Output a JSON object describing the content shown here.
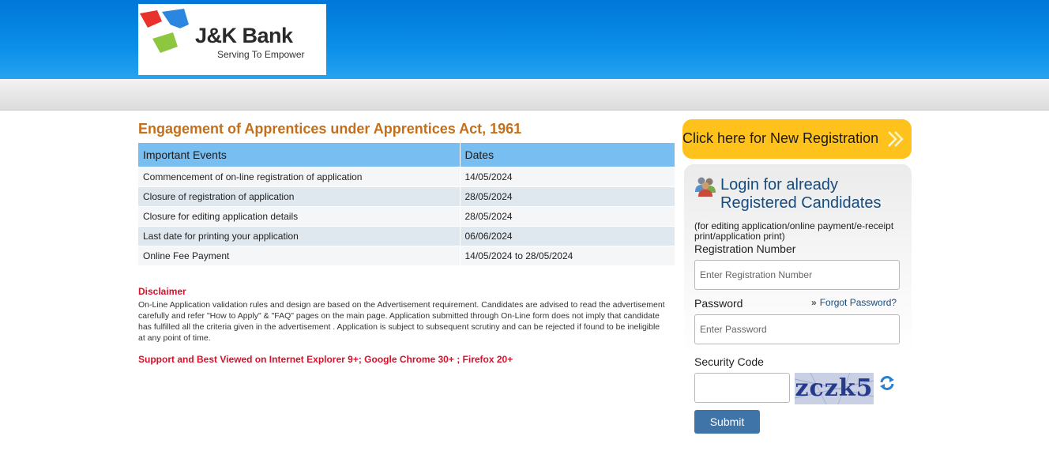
{
  "header": {
    "logo": {
      "name": "J&K Bank",
      "tagline": "Serving To Empower"
    }
  },
  "main": {
    "title": "Engagement of Apprentices under Apprentices Act, 1961",
    "table": {
      "headers": [
        "Important Events",
        "Dates"
      ],
      "rows": [
        {
          "event": "Commencement of on-line registration of application",
          "date": "14/05/2024"
        },
        {
          "event": "Closure of registration of application",
          "date": "28/05/2024"
        },
        {
          "event": "Closure for editing application details",
          "date": "28/05/2024"
        },
        {
          "event": "Last date for printing your application",
          "date": "06/06/2024"
        },
        {
          "event": "Online Fee Payment",
          "date": "14/05/2024 to 28/05/2024"
        }
      ]
    },
    "disclaimer": {
      "title": "Disclaimer",
      "text": "On-Line Application validation rules and design are based on the Advertisement requirement. Candidates are advised to read the advertisement carefully and refer \"How to Apply\" & \"FAQ\" pages on the main page. Application submitted through On-Line form does not imply that candidate has fulfilled all the criteria given in the advertisement . Application is subject to subsequent scrutiny and can be rejected if found to be ineligible at any point of time."
    },
    "support_note": "Support and Best Viewed on Internet Explorer 9+; Google Chrome 30+ ; Firefox 20+"
  },
  "sidebar": {
    "new_registration_label": "Click here for New Registration",
    "login": {
      "title": "Login for already Registered Candidates",
      "subtitle": "(for editing application/online payment/e-receipt print/application print)",
      "registration_label": "Registration Number",
      "registration_placeholder": "Enter Registration Number",
      "password_label": "Password",
      "password_placeholder": "Enter Password",
      "forgot_label": "Forgot Password?",
      "security_label": "Security Code",
      "captcha_text": "zczk5",
      "submit_label": "Submit"
    }
  },
  "colors": {
    "header_blue": "#0a8fe8",
    "title_orange": "#c46f1b",
    "table_header": "#79bef0",
    "alert_red": "#d8102a",
    "new_reg_yellow": "#ffc21d",
    "link_blue": "#164b80",
    "submit_blue": "#3f74a8"
  },
  "icons": {
    "users": "users-group-icon",
    "arrow": "double-chevron-right-icon",
    "refresh": "refresh-icon"
  }
}
